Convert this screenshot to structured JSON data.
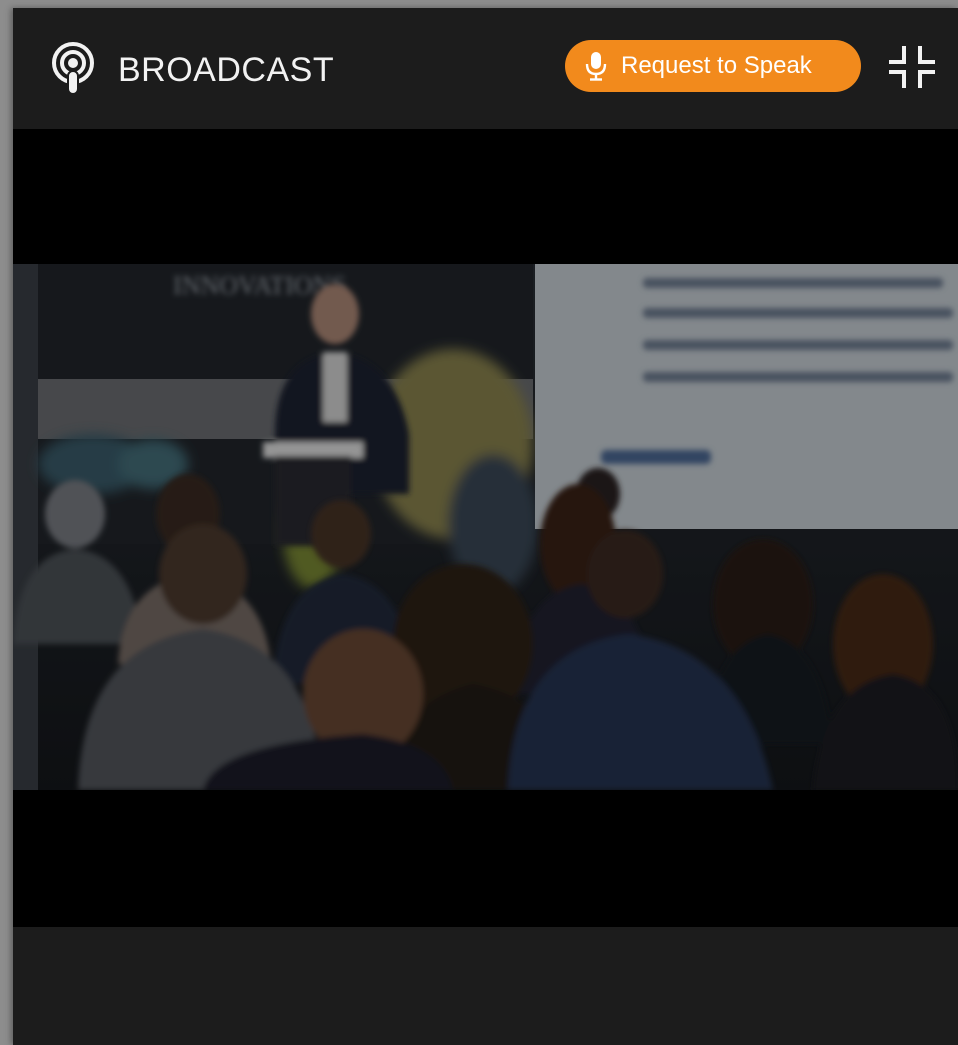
{
  "header": {
    "title": "BROADCAST",
    "broadcast_icon": "podcast-icon",
    "request_button_label": "Request to Speak",
    "request_button_icon": "microphone-icon",
    "collapse_icon": "collapse-fullscreen-icon"
  },
  "video": {
    "scene_icon": "conference-video-frame",
    "poster_text": "INNOVATIONS"
  },
  "colors": {
    "background": "#1c1c1c",
    "accent": "#f28a1c",
    "text": "#f2f2f2"
  }
}
